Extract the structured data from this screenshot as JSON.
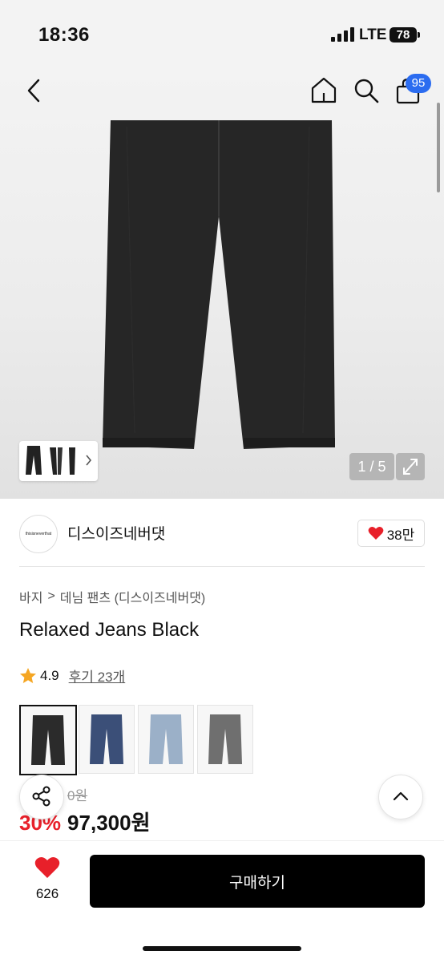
{
  "status": {
    "time": "18:36",
    "network": "LTE",
    "battery": "78"
  },
  "nav": {
    "cart_badge": "95"
  },
  "gallery": {
    "counter": "1 / 5"
  },
  "brand": {
    "logo_text": "thisisneverthat",
    "name": "디스이즈네버댓",
    "likes": "38만"
  },
  "breadcrumb": {
    "category": "바지",
    "separator": ">",
    "subcategory": "데님 팬츠 (디스이즈네버댓)"
  },
  "product": {
    "title": "Relaxed Jeans Black",
    "rating": "4.9",
    "reviews": "후기 23개"
  },
  "swatches": [
    {
      "color": "#2b2b2b",
      "selected": true
    },
    {
      "color": "#3b4f78",
      "selected": false
    },
    {
      "color": "#9bb0c8",
      "selected": false
    },
    {
      "color": "#6f6f6f",
      "selected": false
    }
  ],
  "price": {
    "original": "0원",
    "discount": "30%",
    "sale": "97,300원"
  },
  "bottom": {
    "wish_count": "626",
    "buy_label": "구매하기"
  },
  "colors": {
    "accent_blue": "#2b6cf0",
    "heart_red": "#e8202a",
    "star": "#f5a623"
  }
}
